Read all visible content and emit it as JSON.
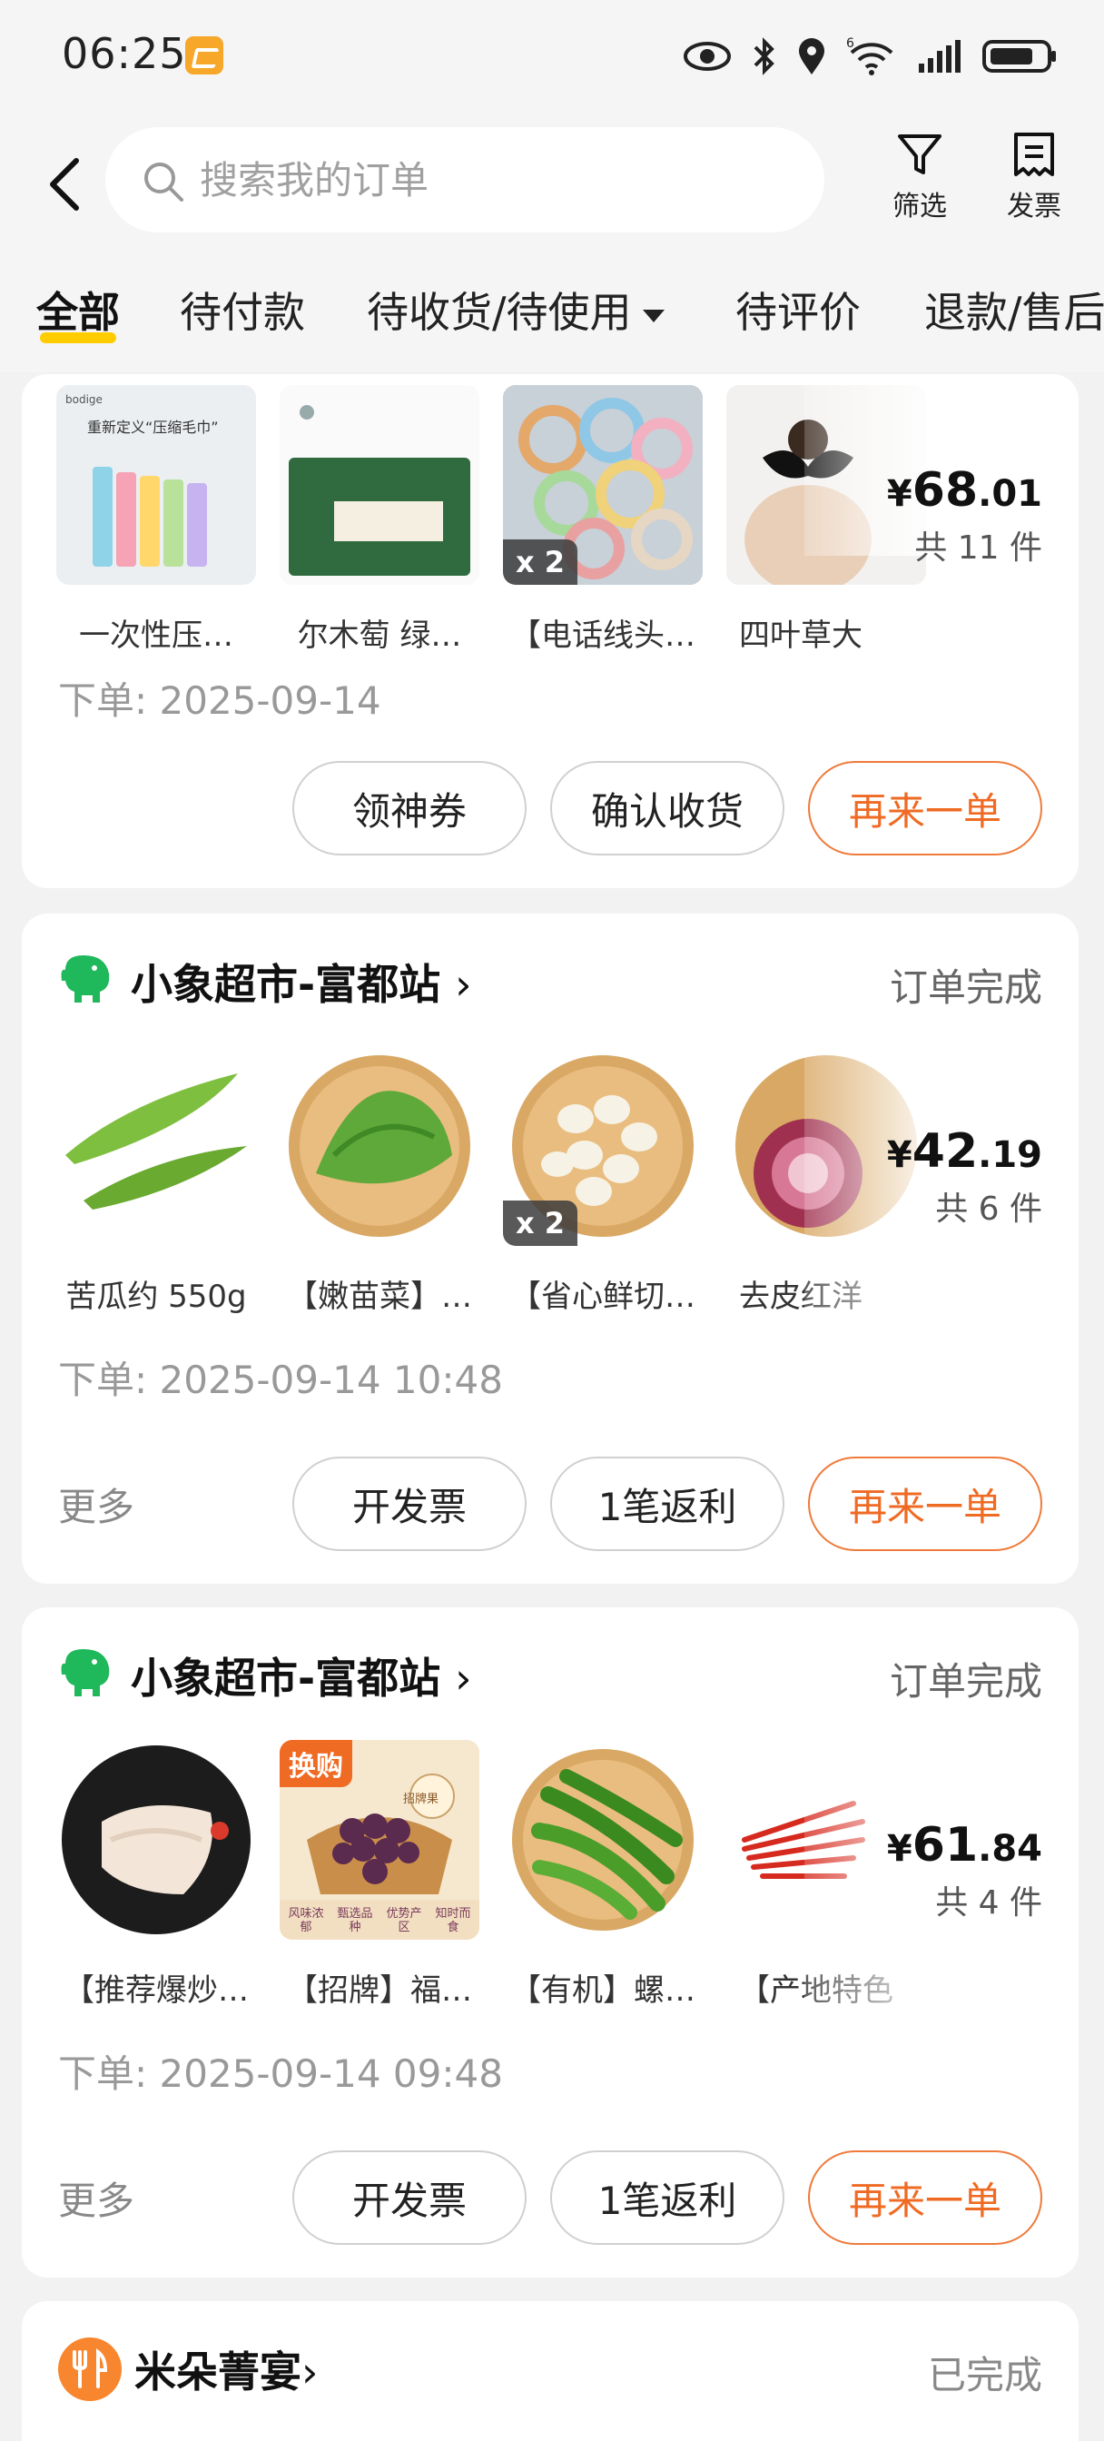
{
  "status_bar": {
    "time": "06:25",
    "icons": [
      "eye-icon",
      "bluetooth-icon",
      "location-icon",
      "wifi-6-icon",
      "signal-icon",
      "battery-icon"
    ]
  },
  "header": {
    "search_placeholder": "搜索我的订单",
    "filter_label": "筛选",
    "invoice_label": "发票"
  },
  "tabs": [
    {
      "label": "全部",
      "active": true
    },
    {
      "label": "待付款"
    },
    {
      "label": "待收货/待使用"
    },
    {
      "label": "待评价"
    },
    {
      "label": "退款/售后"
    }
  ],
  "orders": [
    {
      "items": [
        {
          "caption": "一次性压…",
          "qty": ""
        },
        {
          "caption": "尔木萄 绿…",
          "qty": ""
        },
        {
          "caption": "【电话线头…",
          "qty": "x 2"
        },
        {
          "caption": "四叶草大",
          "qty": ""
        }
      ],
      "price_int": "68",
      "price_dec": ".01",
      "currency": "¥",
      "count": "共 11 件",
      "date": "下单: 2025-09-14",
      "buttons": [
        "领神券",
        "确认收货",
        "再来一单"
      ]
    },
    {
      "store": "小象超市-富都站",
      "status": "订单完成",
      "items": [
        {
          "caption": "苦瓜约 550g",
          "qty": ""
        },
        {
          "caption": "【嫩苗菜】…",
          "qty": ""
        },
        {
          "caption": "【省心鲜切…",
          "qty": "x 2"
        },
        {
          "caption": "去皮红洋",
          "qty": ""
        }
      ],
      "price_int": "42",
      "price_dec": ".19",
      "currency": "¥",
      "count": "共 6 件",
      "date": "下单: 2025-09-14 10:48",
      "more": "更多",
      "buttons": [
        "开发票",
        "1笔返利",
        "再来一单"
      ]
    },
    {
      "store": "小象超市-富都站",
      "status": "订单完成",
      "items": [
        {
          "caption": "【推荐爆炒…",
          "qty": ""
        },
        {
          "caption": "【招牌】福…",
          "qty": "",
          "badge": "换购",
          "tags": [
            "风味浓郁",
            "甄选品种",
            "优势产区",
            "知时而食"
          ],
          "brand": "招牌果"
        },
        {
          "caption": "【有机】螺…",
          "qty": ""
        },
        {
          "caption": "【产地特色",
          "qty": ""
        }
      ],
      "price_int": "61",
      "price_dec": ".84",
      "currency": "¥",
      "count": "共 4 件",
      "date": "下单: 2025-09-14 09:48",
      "more": "更多",
      "buttons": [
        "开发票",
        "1笔返利",
        "再来一单"
      ]
    },
    {
      "store": "米朵菁宴",
      "status": "已完成"
    }
  ],
  "product_card1_texts": {
    "towel_title": "重新定义“压缩毛巾”",
    "towel_brand": "bodige"
  },
  "colors": {
    "accent_orange": "#ef6a23",
    "tab_underline": "#ffcc00",
    "store_green": "#1fb85a"
  }
}
